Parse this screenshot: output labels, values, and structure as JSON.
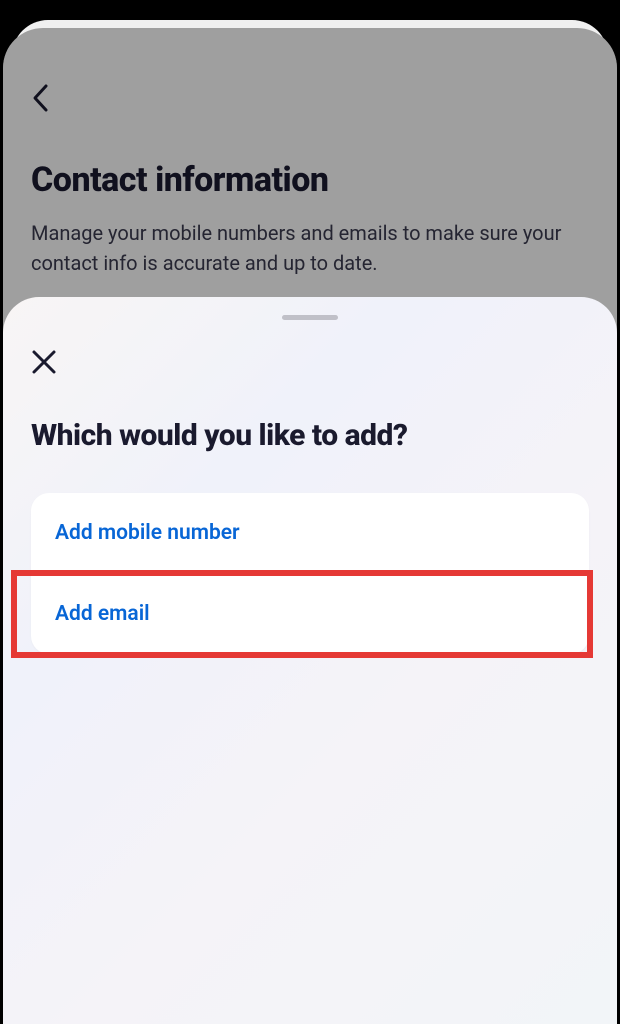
{
  "background": {
    "title": "Contact information",
    "description": "Manage your mobile numbers and emails to make sure your contact info is accurate and up to date."
  },
  "modal": {
    "title": "Which would you like to add?",
    "options": [
      {
        "label": "Add mobile number"
      },
      {
        "label": "Add email"
      }
    ]
  }
}
